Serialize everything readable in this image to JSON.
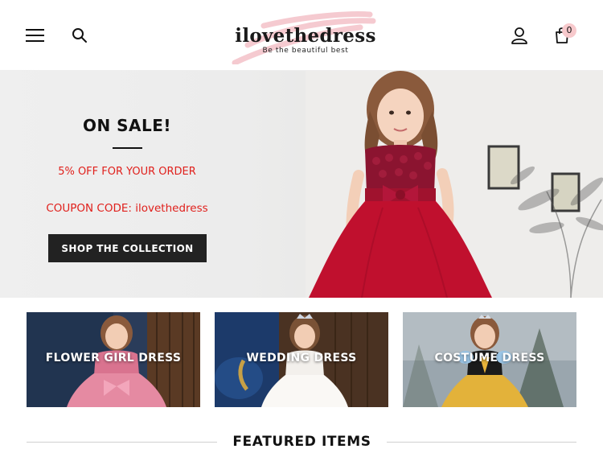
{
  "header": {
    "logo_text": "ilovethedress",
    "tagline": "Be the beautiful best",
    "cart_count": "0",
    "icons": [
      "menu-icon",
      "search-icon",
      "user-icon",
      "shopping-bag-icon"
    ]
  },
  "hero": {
    "title": "ON SALE!",
    "offer": "5% OFF FOR YOUR ORDER",
    "coupon": "COUPON CODE: ilovethedress",
    "cta_label": "SHOP THE COLLECTION"
  },
  "categories": [
    {
      "label": "FLOWER GIRL DRESS"
    },
    {
      "label": "WEDDING DRESS"
    },
    {
      "label": "COSTUME DRESS"
    }
  ],
  "featured": {
    "title": "FEATURED ITEMS"
  },
  "colors": {
    "accent_red": "#e0201c",
    "dark_button": "#222222",
    "cart_badge": "#f7c9cc",
    "logo_stroke": "#f2b8c0"
  }
}
